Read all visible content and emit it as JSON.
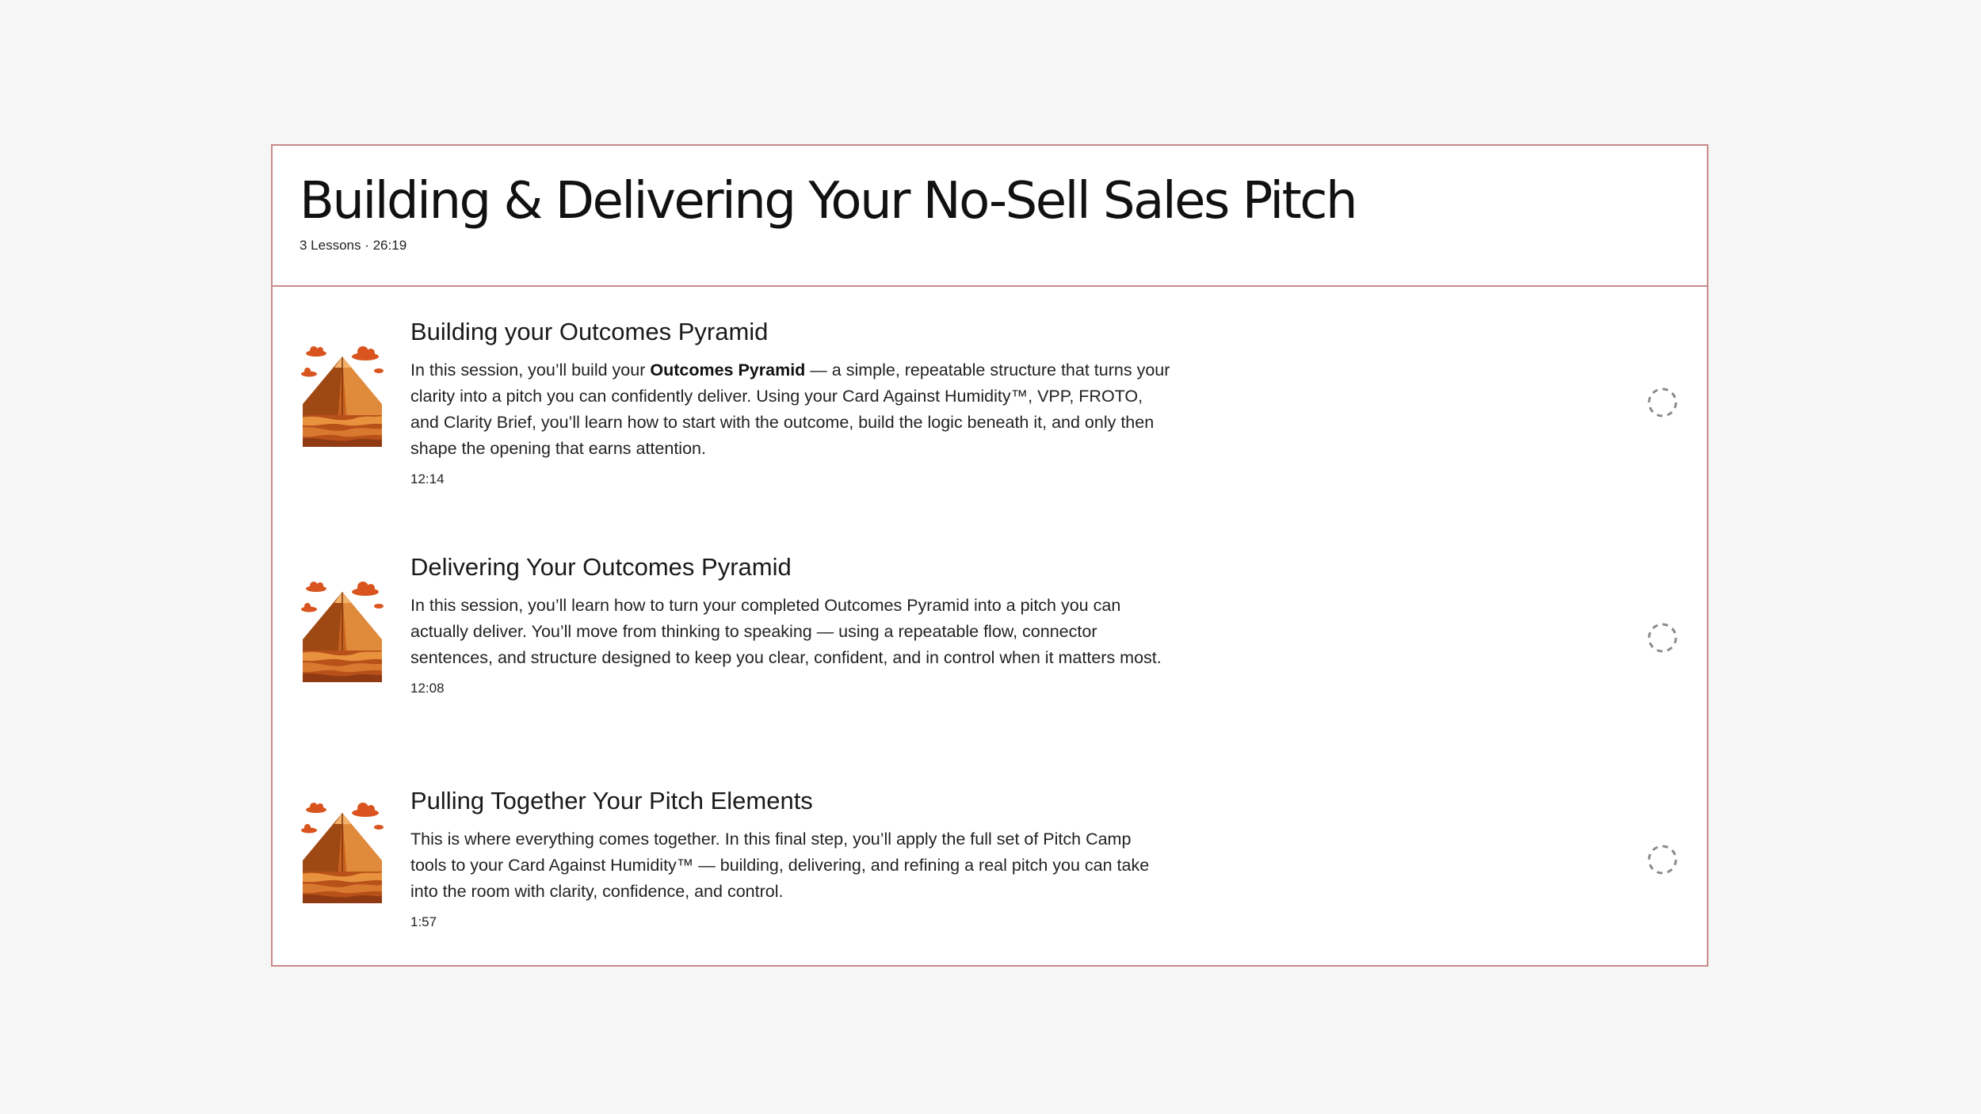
{
  "module": {
    "title": "Building & Delivering Your No-Sell Sales Pitch",
    "meta": "3 Lessons · 26:19"
  },
  "lessons": [
    {
      "title": "Building your Outcomes Pyramid",
      "desc_before": "In this session, you’ll build your ",
      "desc_bold": "Outcomes Pyramid",
      "desc_after": " — a simple, repeatable structure that turns your clarity into a pitch you can confidently deliver. Using your Card Against Humidity™, VPP, FROTO, and Clarity Brief, you’ll learn how to start with the outcome, build the logic beneath it, and only then shape the opening that earns attention.",
      "duration": "12:14",
      "thumbnail_icon": "pyramid-thumbnail",
      "status_icon": "incomplete-circle-icon"
    },
    {
      "title": "Delivering Your Outcomes Pyramid",
      "desc_before": "In this session, you’ll learn how to turn your completed Outcomes Pyramid into a pitch you can actually deliver. You’ll move from thinking to speaking — using a repeatable flow, connector sentences, and structure designed to keep you clear, confident, and in control when it matters most.",
      "desc_bold": "",
      "desc_after": "",
      "duration": "12:08",
      "thumbnail_icon": "pyramid-thumbnail",
      "status_icon": "incomplete-circle-icon"
    },
    {
      "title": "Pulling Together Your Pitch Elements",
      "desc_before": "This is where everything comes together. In this final step, you’ll apply the full set of Pitch Camp tools to your Card Against Humidity™ — building, delivering, and refining a real pitch you can take into the room with clarity, confidence, and control.",
      "desc_bold": "",
      "desc_after": "",
      "duration": "1:57",
      "thumbnail_icon": "pyramid-thumbnail",
      "status_icon": "incomplete-circle-icon"
    }
  ],
  "colors": {
    "page_background": "#f6f6f6",
    "card_border": "#c98a8a",
    "pyramid_orange": "#d2691e",
    "cloud_orange": "#d9541e",
    "status_circle": "#8a8a8a"
  }
}
